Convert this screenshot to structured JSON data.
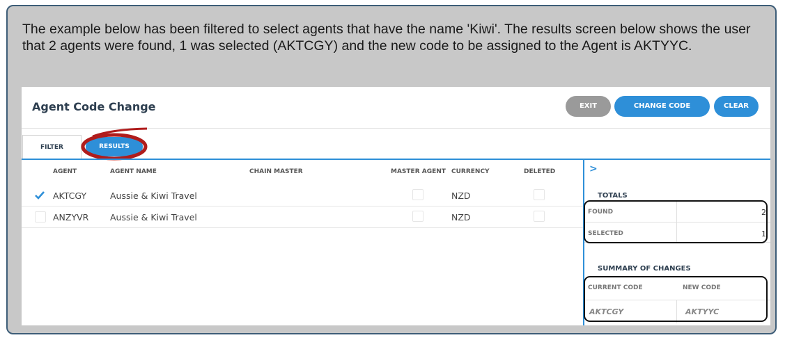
{
  "intro_text": "The example below has been filtered to select agents that have the name 'Kiwi'. The results screen below shows the user that 2 agents were found, 1 was selected (AKTCGY) and the new code to be assigned to the Agent is AKTYYC.",
  "app": {
    "title": "Agent Code Change",
    "buttons": {
      "exit": "EXIT",
      "change_code": "CHANGE CODE",
      "clear": "CLEAR"
    },
    "tabs": {
      "filter": "FILTER",
      "results": "RESULTS"
    },
    "columns": [
      "AGENT",
      "AGENT NAME",
      "CHAIN MASTER",
      "MASTER AGENT",
      "CURRENCY",
      "DELETED"
    ],
    "rows": [
      {
        "selected": true,
        "agent": "AKTCGY",
        "name": "Aussie & Kiwi Travel",
        "currency": "NZD"
      },
      {
        "selected": false,
        "agent": "ANZYVR",
        "name": "Aussie & Kiwi Travel",
        "currency": "NZD"
      }
    ],
    "totals": {
      "title": "TOTALS",
      "found_label": "FOUND",
      "found": "2",
      "selected_label": "SELECTED",
      "selected": "1"
    },
    "summary": {
      "title": "SUMMARY OF CHANGES",
      "current_label": "CURRENT CODE",
      "new_label": "NEW CODE",
      "current": "AKTCGY",
      "new": "AKTYYC"
    }
  },
  "colors": {
    "accent": "#2e8fd8",
    "annotation": "#b01c1c",
    "callout_bg": "#c8c8c8",
    "callout_border": "#3d5d78"
  }
}
